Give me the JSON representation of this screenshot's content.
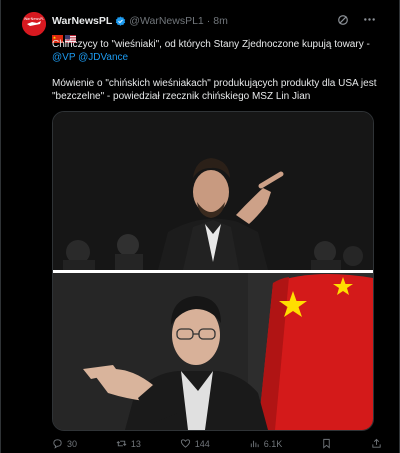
{
  "tweet": {
    "author_name": "WarNewsPL",
    "handle": "@WarNewsPL1",
    "separator": "·",
    "time": "8m",
    "avatar_label": "WarNewsPL",
    "flags": [
      "china-flag",
      "usa-flag"
    ],
    "lines": [
      "Chińczycy to \"wieśniaki\", od których Stany Zjednoczone kupują towary -",
      "Mówienie o \"chińskich wieśniakach\" produkujących produkty dla USA jest",
      "\"bezczelne\" - powiedział rzecznik chińskiego MSZ Lin Jian"
    ],
    "mentions": [
      "@VP",
      "@JDVance"
    ]
  },
  "media": {
    "top_photo": "man-pointing-at-podium",
    "bottom_photo": "spokesman-gesturing-with-chinese-flag"
  },
  "actions": {
    "replies": "30",
    "reposts": "13",
    "likes": "144",
    "views": "6.1K"
  },
  "icons": {
    "grok": "grok-icon",
    "more": "more-icon",
    "reply": "reply-icon",
    "repost": "repost-icon",
    "like": "like-icon",
    "views": "views-icon",
    "bookmark": "bookmark-icon",
    "share": "share-icon"
  },
  "colors": {
    "background": "#000000",
    "text": "#e7e9ea",
    "muted": "#71767b",
    "accent": "#1d9bf0",
    "avatar": "#d71920"
  }
}
